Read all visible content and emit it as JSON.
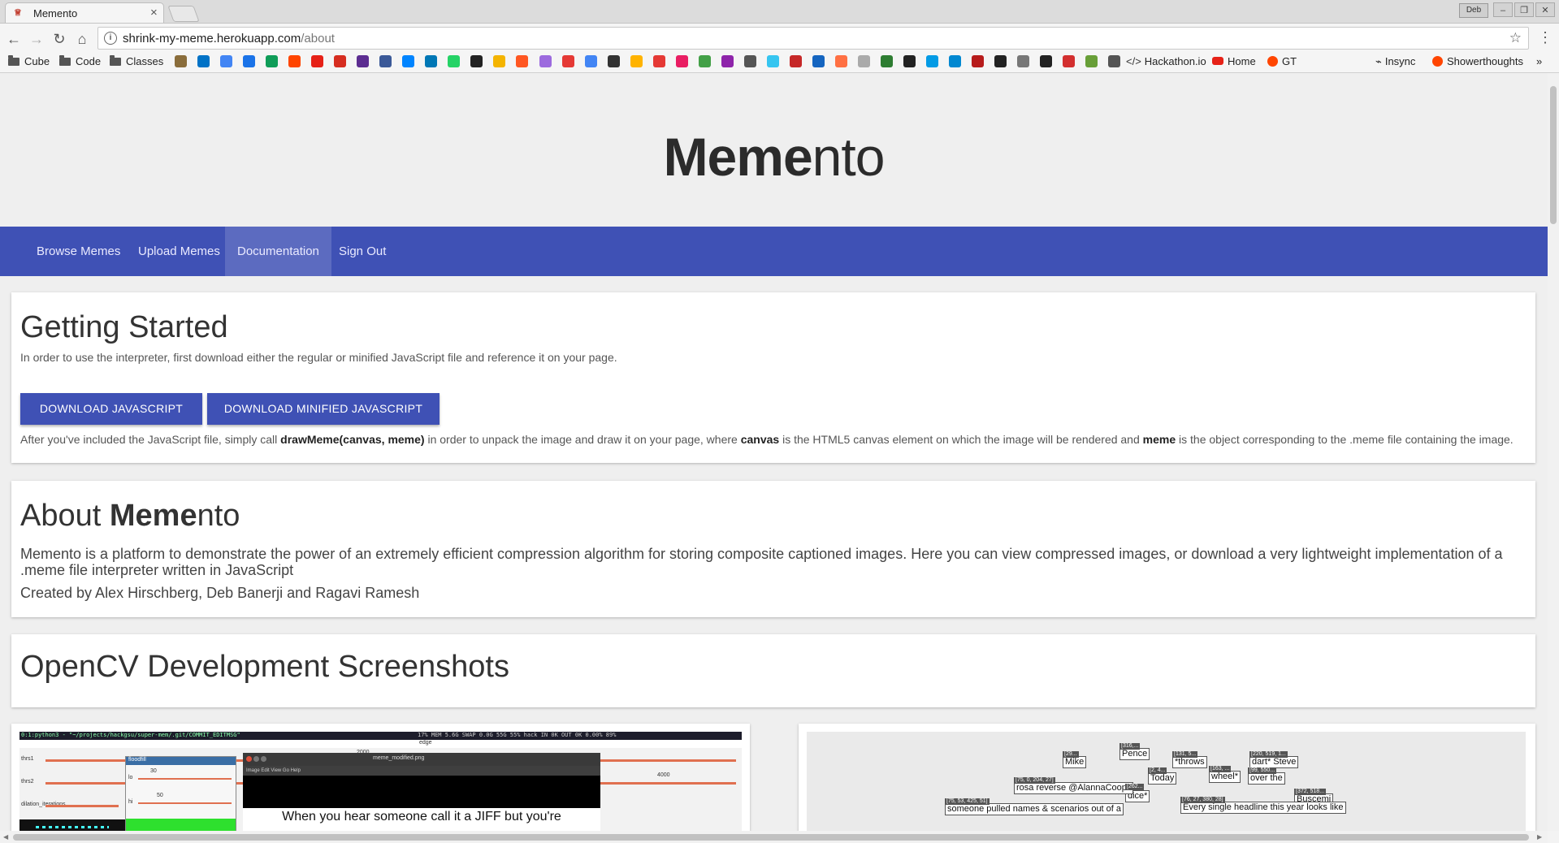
{
  "browser": {
    "tab_title": "Memento",
    "tab_close": "×",
    "user_badge": "Deb",
    "url_host": "shrink-my-meme.herokuapp.com",
    "url_path": "/about",
    "bookmarks": {
      "cube": "Cube",
      "code": "Code",
      "classes": "Classes",
      "hackathon": "Hackathon.io",
      "home": "Home",
      "gt": "GT",
      "insync": "Insync",
      "showerthoughts": "Showerthoughts",
      "more": "»"
    }
  },
  "site": {
    "brand_bold": "Meme",
    "brand_light": "nto",
    "nav": {
      "browse": "Browse Memes",
      "upload": "Upload Memes",
      "docs": "Documentation",
      "signout": "Sign Out"
    }
  },
  "getting_started": {
    "title": "Getting Started",
    "intro": "In order to use the interpreter, first download either the regular or minified JavaScript file and reference it on your page.",
    "btn_js": "DOWNLOAD JAVASCRIPT",
    "btn_min": "DOWNLOAD MINIFIED JAVASCRIPT",
    "usage_1": "After you've included the JavaScript file, simply call ",
    "usage_code": "drawMeme(canvas, meme)",
    "usage_2": " in order to unpack the image and draw it on your page, where ",
    "usage_canvas": "canvas",
    "usage_3": " is the HTML5 canvas element on which the image will be rendered and ",
    "usage_meme": "meme",
    "usage_4": " is the object corresponding to the .meme file containing the image."
  },
  "about": {
    "title_prefix": "About ",
    "title_bold": "Meme",
    "title_light": "nto",
    "description": "Memento is a platform to demonstrate the power of an extremely efficient compression algorithm for storing composite captioned images. Here you can view compressed images, or download a very lightweight implementation of a .meme file interpreter written in JavaScript",
    "credits": "Created by Alex Hirschberg, Deb Banerji and Ragavi Ramesh"
  },
  "opencv": {
    "title": "OpenCV Development Screenshots",
    "left": {
      "statusbar": "0:1:python3 - \"~/projects/hackgsu/super-mem/.git/COMMIT_EDITMSG\"",
      "status_right": "17%  MEM 5.6G  SWAP 0.0G  55G  55% hack  IN 0K OUT 0K  0.00%  89%",
      "edge_label": "edge",
      "thrs1": "thrs1",
      "thrs2": "thrs2",
      "dilation": "dilation_iterations",
      "v2000": "2000",
      "v4000": "4000",
      "floodfill": "floodfill",
      "lo": "lo",
      "hi": "hi",
      "v30": "30",
      "v50": "50",
      "window_title": "meme_modified.png",
      "menu": "Image   Edit   View   Go   Help",
      "caption": "When you hear someone call it a JIFF but you're"
    },
    "right": {
      "boxes": [
        "Mike",
        "Pence",
        "*throws",
        "dart* Steve",
        "Today",
        "wheel*",
        "over the",
        "dice*",
        "rosa reverse @AlannaCoops",
        "Buscemi",
        "someone pulled names & scenarios out of a",
        "Every single headline this year looks like"
      ],
      "tags": [
        "[29...",
        "[316,...",
        "[131, 5...",
        "[220, 519, 1...",
        "[2, 4...",
        "[163, ...",
        "[99, 550...",
        "[262...",
        "[75, 0, 204, 27]",
        "[372, 518...",
        "[75, 53, 425, 51]",
        "[76, 27, 380, 28]"
      ]
    }
  }
}
